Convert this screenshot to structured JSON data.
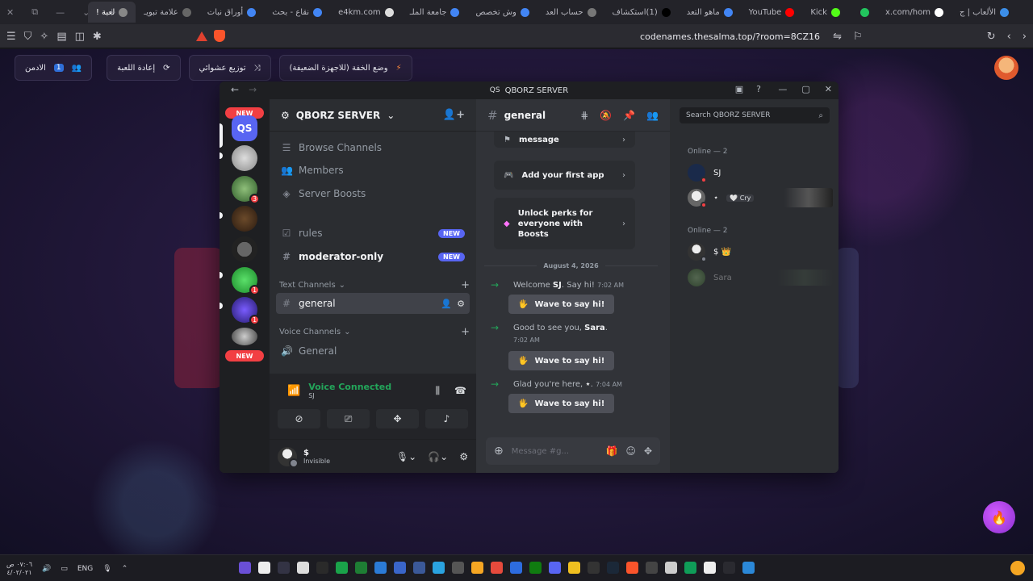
{
  "browser": {
    "tabs": [
      {
        "label": "الألعاب | ج",
        "color": "#3c8ee8"
      },
      {
        "label": "x.com/hom",
        "color": "#ffffff",
        "icon": "x-icon"
      },
      {
        "label": "",
        "color": "#22c55e",
        "icon": "kick-icon"
      },
      {
        "label": "Kick",
        "color": "#53fc18"
      },
      {
        "label": "YouTube",
        "color": "#ff0000"
      },
      {
        "label": "ماهو التعد",
        "color": "#4285f4"
      },
      {
        "label": "(1)استكشاف",
        "color": "#000000"
      },
      {
        "label": "حساب العد",
        "color": "#777777"
      },
      {
        "label": "وش تخصص",
        "color": "#4285f4"
      },
      {
        "label": "جامعة الملـ",
        "color": "#4285f4"
      },
      {
        "label": "e4km.com",
        "color": "#dddddd"
      },
      {
        "label": "نقاع - بحث",
        "color": "#4285f4"
      },
      {
        "label": "أوراق نبات",
        "color": "#4285f4"
      },
      {
        "label": "علامة تبويـ",
        "color": "#666666"
      },
      {
        "label": "لعبة !",
        "color": "#888888",
        "active": true
      }
    ],
    "url": "codenames.thesalma.top/?room=8CZ16",
    "brave_badge": "1"
  },
  "game": {
    "admin_label": "الادمن",
    "admin_count": "1",
    "restart_label": "إعادة اللعبة",
    "shuffle_label": "توزيع عشوائي",
    "lite_mode_label": "وضع الخفة (للاجهزة الضعيفة)"
  },
  "discord": {
    "window_title": "QBORZ SERVER",
    "server_name": "QBORZ SERVER",
    "guild_new_top": "NEW",
    "guild_new_bottom": "NEW",
    "guild_qs": "QS",
    "guild_badges": [
      "3",
      "1",
      "1"
    ],
    "nav": {
      "browse": "Browse Channels",
      "members": "Members",
      "boosts": "Server Boosts"
    },
    "channels_top": [
      {
        "name": "rules",
        "tag": "NEW"
      },
      {
        "name": "moderator-only",
        "tag": "NEW"
      }
    ],
    "text_category": "Text Channels",
    "selected_channel": "general",
    "voice_category": "Voice Channels",
    "voice_channel": "General",
    "voice_connected": "Voice Connected",
    "voice_connected_sub": "SJ",
    "user": {
      "name": "$",
      "status": "Invisible"
    },
    "chat": {
      "channel": "general",
      "card_message": "message",
      "card_add_app": "Add your first app",
      "card_unlock": "Unlock perks for everyone with Boosts",
      "date": "August 4, 2026",
      "joins": [
        {
          "pre": "Welcome ",
          "name": "SJ",
          "post": ". Say hi!",
          "time": "7:02 AM"
        },
        {
          "pre": "Good to see you, ",
          "name": "Sara",
          "post": ".",
          "time": "7:02 AM"
        },
        {
          "pre": "Glad you're here, ",
          "name": "⋆",
          "post": ".",
          "time": "7:04 AM"
        }
      ],
      "wave_label": "Wave to say hi!",
      "composer_placeholder": "Message #g..."
    },
    "members_panel": {
      "search_placeholder": "Search QBORZ SERVER",
      "online_header": "Online — 2",
      "offline_header": "Online — 2",
      "online": [
        {
          "name": "SJ",
          "tag": ""
        },
        {
          "name": "⋆",
          "tag": "🤍 Cry"
        }
      ],
      "offline": [
        {
          "name": "$ 👑",
          "tag": ""
        },
        {
          "name": "Sara",
          "tag": ""
        }
      ]
    }
  },
  "taskbar": {
    "time": "٠٧:٠٦ ص",
    "date": "٤/٠٢/٠٢١",
    "lang": "ENG"
  }
}
